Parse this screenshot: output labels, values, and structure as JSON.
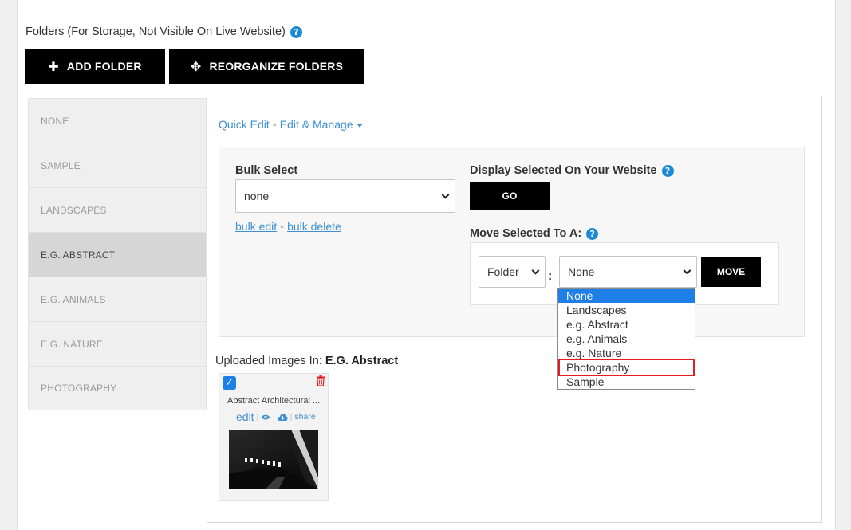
{
  "folders_section": {
    "title": "Folders (For Storage, Not Visible On Live Website)",
    "help_icon": "question-circle-icon",
    "add_folder_label": "ADD FOLDER",
    "reorganize_label": "REORGANIZE FOLDERS"
  },
  "sidebar": {
    "items": [
      {
        "label": "NONE",
        "active": false
      },
      {
        "label": "SAMPLE",
        "active": false
      },
      {
        "label": "LANDSCAPES",
        "active": false
      },
      {
        "label": "E.G. ABSTRACT",
        "active": true
      },
      {
        "label": "E.G. ANIMALS",
        "active": false
      },
      {
        "label": "E.G. NATURE",
        "active": false
      },
      {
        "label": "PHOTOGRAPHY",
        "active": false
      }
    ]
  },
  "toolbar": {
    "quick_edit": "Quick Edit",
    "edit_manage": "Edit & Manage"
  },
  "bulk": {
    "label": "Bulk Select",
    "selected": "none",
    "bulk_edit": "bulk edit",
    "bulk_delete": "bulk delete"
  },
  "display": {
    "label": "Display Selected On Your Website",
    "go_label": "GO"
  },
  "move": {
    "label": "Move Selected To A:",
    "type_selected": "Folder",
    "target_selected": "None",
    "move_label": "MOVE",
    "colon": ":",
    "options": [
      "None",
      "Landscapes",
      "e.g. Abstract",
      "e.g. Animals",
      "e.g. Nature",
      "Photography",
      "Sample"
    ]
  },
  "uploaded": {
    "prefix": "Uploaded Images In: ",
    "folder": "E.G. Abstract"
  },
  "image_card": {
    "title": "Abstract Architectural ...",
    "edit": "edit",
    "share": "share",
    "checked": true
  },
  "colors": {
    "accent_blue": "#1e7fe6",
    "link_blue": "#3f8fd1",
    "highlight_red": "#e31b23"
  }
}
